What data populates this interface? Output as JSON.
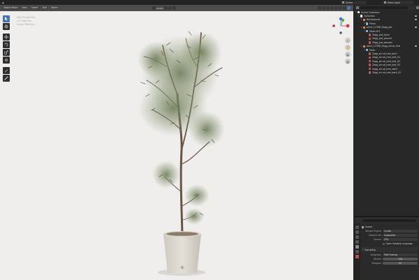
{
  "topbar": {
    "scene": "Scene",
    "view_layer": "View Layer"
  },
  "viewport_header": {
    "mode": "Object Mode",
    "menu": [
      "View",
      "Select",
      "Add",
      "Object"
    ],
    "orientation": "Global",
    "options": "Options"
  },
  "viewport_info": {
    "line1": "User Perspective",
    "line2": "(1) Collection",
    "line3": "Scene Statistics"
  },
  "toolbar": {
    "tools": [
      "select-box",
      "cursor",
      "move",
      "rotate",
      "scale",
      "transform",
      "annotate",
      "measure"
    ]
  },
  "outliner": {
    "items": [
      {
        "label": "Scene Collection",
        "depth": 0,
        "icon": "collection",
        "eye": false
      },
      {
        "label": "Collection",
        "depth": 1,
        "icon": "collection",
        "eye": true
      },
      {
        "label": "Background",
        "depth": 2,
        "icon": "object",
        "eye": true
      },
      {
        "label": "Plane",
        "depth": 3,
        "icon": "mesh",
        "eye": false
      },
      {
        "label": "plant_11996_Zagg_pot",
        "depth": 2,
        "icon": "object",
        "eye": true
      },
      {
        "label": "Mesh.001",
        "depth": 3,
        "icon": "mesh",
        "eye": false
      },
      {
        "label": "Zagg_pot_dryin",
        "depth": 4,
        "icon": "material",
        "eye": false
      },
      {
        "label": "Zagg_pot_ground",
        "depth": 4,
        "icon": "material",
        "eye": false
      },
      {
        "label": "Zagg_pot_wooden",
        "depth": 4,
        "icon": "material",
        "eye": false
      },
      {
        "label": "plant_11996_Zagg_shrub_tree",
        "depth": 2,
        "icon": "object",
        "eye": true
      },
      {
        "label": "Mesh",
        "depth": 3,
        "icon": "mesh",
        "eye": false
      },
      {
        "label": "Zagg_shrub_tree_bark",
        "depth": 4,
        "icon": "material",
        "eye": false
      },
      {
        "label": "Zagg_shrub_tree_leaf_01",
        "depth": 4,
        "icon": "material",
        "eye": false
      },
      {
        "label": "Zagg_shrub_tree_leaf_02",
        "depth": 4,
        "icon": "material",
        "eye": false
      },
      {
        "label": "Zagg_shrub_tree_leaf_03",
        "depth": 4,
        "icon": "material",
        "eye": false
      },
      {
        "label": "Zagg_shrub_tree_stem",
        "depth": 4,
        "icon": "material",
        "eye": false
      },
      {
        "label": "Zagg_shrub_tree_bark_02",
        "depth": 4,
        "icon": "material",
        "eye": false
      }
    ]
  },
  "properties": {
    "scene_name": "Scene",
    "render_engine_label": "Render Engine",
    "render_engine": "Cycles",
    "feature_set_label": "Feature Set",
    "feature_set": "Supported",
    "device_label": "Device",
    "device": "CPU",
    "osl_label": "Open Shading Language",
    "sampling_section": "Sampling",
    "integrator_label": "Integrator",
    "integrator": "Path Tracing",
    "render_label": "Render",
    "render_samples": "128",
    "viewport_label": "Viewport",
    "viewport_samples": "32"
  },
  "colors": {
    "viewport_bg": "#efeeed",
    "accent": "#4772b3",
    "gizmo_x": "#d63a46",
    "gizmo_y": "#6aa730",
    "gizmo_z": "#3f7ce0"
  }
}
